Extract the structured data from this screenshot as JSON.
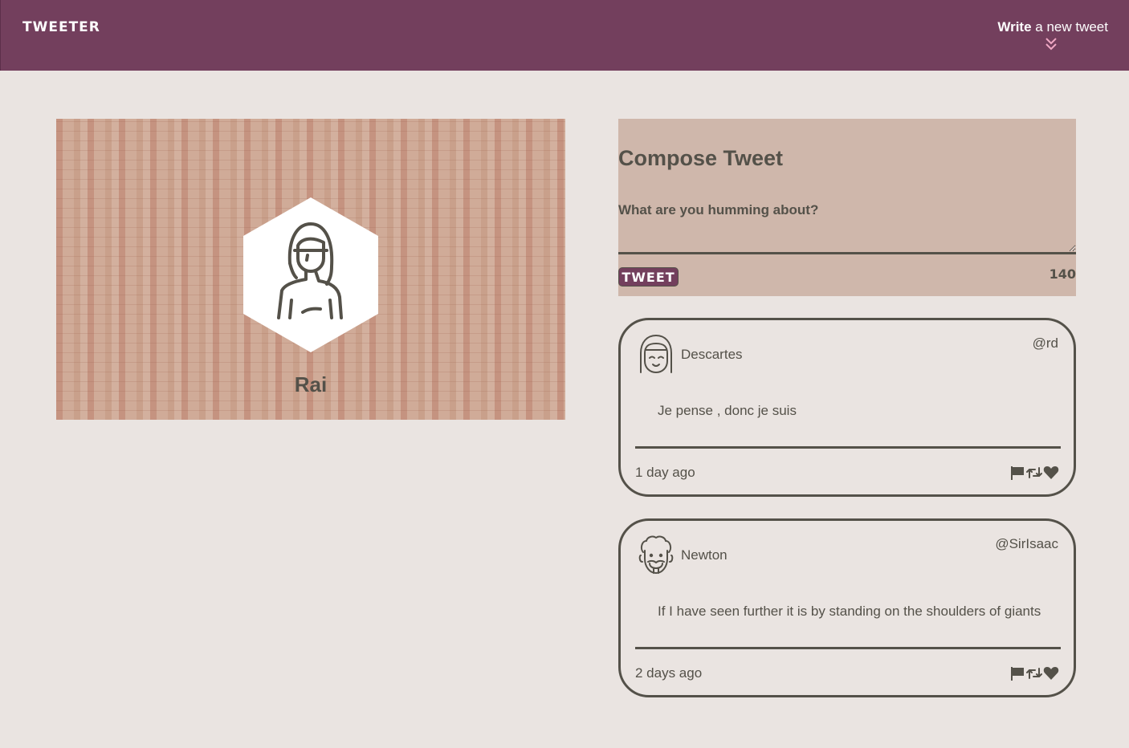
{
  "nav": {
    "brand": "TWEETER",
    "write_bold": "Write",
    "write_rest": " a new tweet",
    "toggle_icon": "double-chevron-down-icon",
    "colors": {
      "background": "#733f5d",
      "text": "#ffffff",
      "chevron": "#f0a8c4"
    }
  },
  "profile": {
    "name": "Rai",
    "avatar_icon": "woman-avatar-icon"
  },
  "compose": {
    "title": "Compose Tweet",
    "placeholder": "What are you humming about?",
    "button_label": "TWEET",
    "counter": "140"
  },
  "tweets": [
    {
      "name": "Descartes",
      "handle": "@rd",
      "text": "Je pense , donc je suis",
      "time": "1 day ago",
      "avatar_icon": "girl-avatar-icon"
    },
    {
      "name": "Newton",
      "handle": "@SirIsaac",
      "text": "If I have seen further it is by standing on the shoulders of giants",
      "time": "2 days ago",
      "avatar_icon": "bearded-man-avatar-icon"
    }
  ],
  "actions": [
    "flag-icon",
    "retweet-icon",
    "heart-icon"
  ],
  "colors": {
    "page_bg": "#eae4e1",
    "text": "#545149",
    "accent": "#733f5d",
    "compose_bg": "#cfb7ab"
  }
}
